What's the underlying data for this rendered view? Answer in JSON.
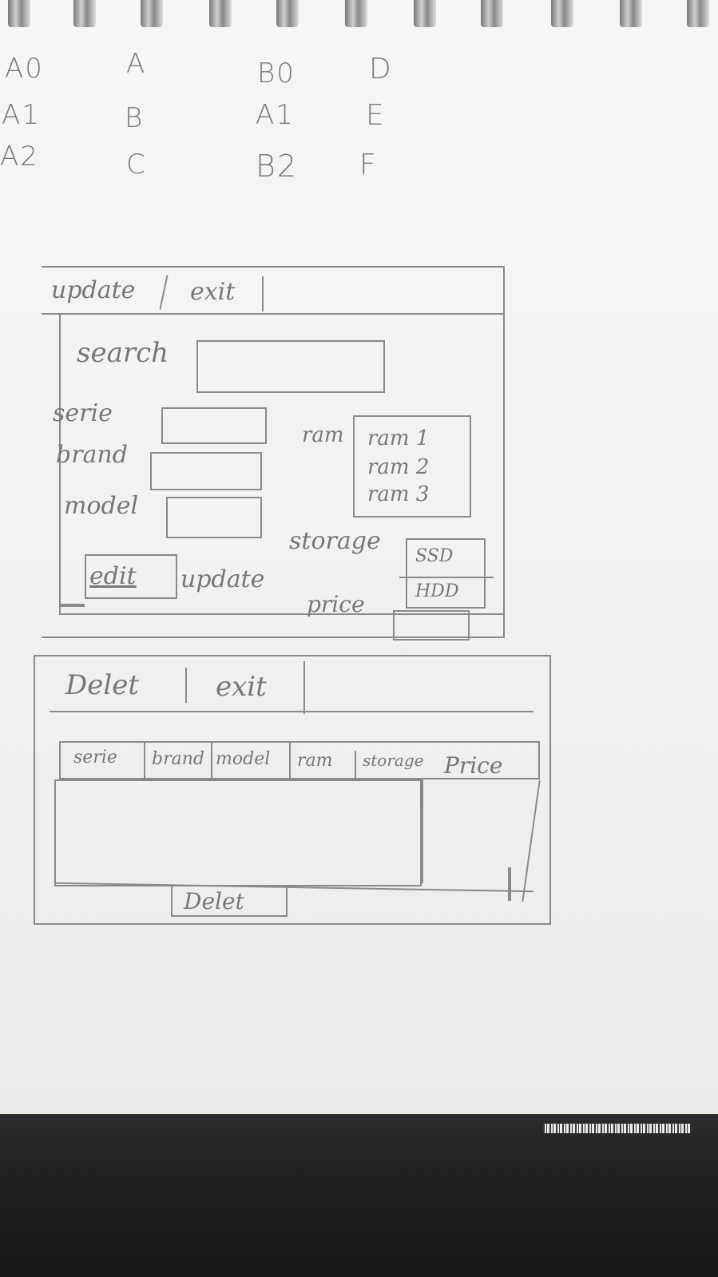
{
  "notes": {
    "col1": [
      "A0",
      "A1",
      "A2"
    ],
    "col2": [
      "A",
      "B",
      "C"
    ],
    "col3": [
      "B0",
      "A1",
      "B2"
    ],
    "col4": [
      "D",
      "E",
      "F"
    ]
  },
  "update_form": {
    "menu": [
      "update",
      "exit"
    ],
    "search_label": "search",
    "fields": {
      "serie": "serie",
      "brand": "brand",
      "model": "model",
      "ram": "ram",
      "storage": "storage",
      "price": "price"
    },
    "ram_options": [
      "ram 1",
      "ram 2",
      "ram 3"
    ],
    "storage_options": [
      "SSD",
      "HDD"
    ],
    "edit_button": "edit",
    "update_button": "update"
  },
  "delete_form": {
    "menu": [
      "Delet",
      "exit"
    ],
    "columns": [
      "serie",
      "brand",
      "model",
      "ram",
      "storage",
      "Price"
    ],
    "delete_button": "Delet"
  }
}
